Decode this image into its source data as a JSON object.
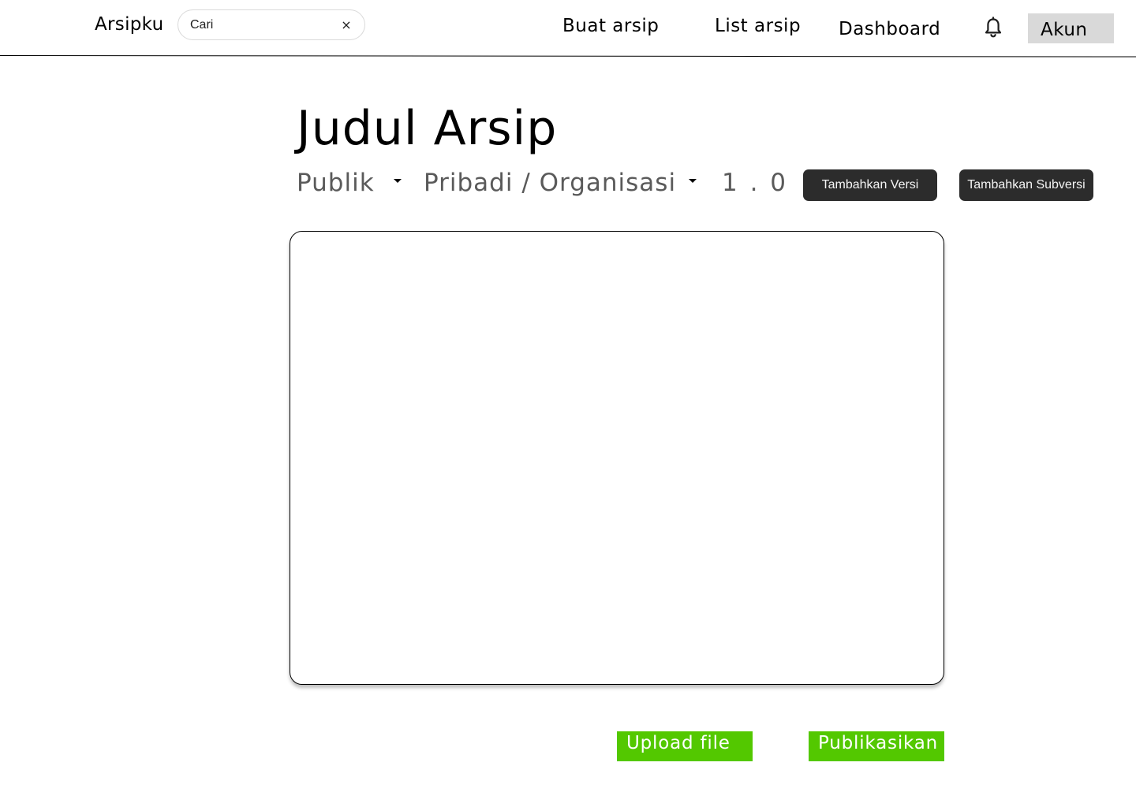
{
  "header": {
    "brand": "Arsipku",
    "search": {
      "placeholder": "Cari",
      "value": "",
      "clear_icon": "×"
    },
    "nav": {
      "buat_arsip": "Buat arsip",
      "list_arsip": "List arsip",
      "dashboard": "Dashboard"
    },
    "notification_icon": "bell-icon",
    "account": "Akun"
  },
  "archive": {
    "title": "Judul Arsip",
    "visibility": {
      "selected": "Publik"
    },
    "ownership": {
      "selected": "Pribadi / Organisasi"
    },
    "version": "1 . 0",
    "add_version_label": "Tambahkan Versi",
    "add_subversion_label": "Tambahkan Subversi"
  },
  "actions": {
    "upload_label": "Upload file",
    "publish_label": "Publikasikan"
  },
  "colors": {
    "primary_green": "#53c800",
    "dark_button": "#2c2c2c",
    "account_bg": "#d9d9d9",
    "muted_text": "#5a5a5a"
  }
}
